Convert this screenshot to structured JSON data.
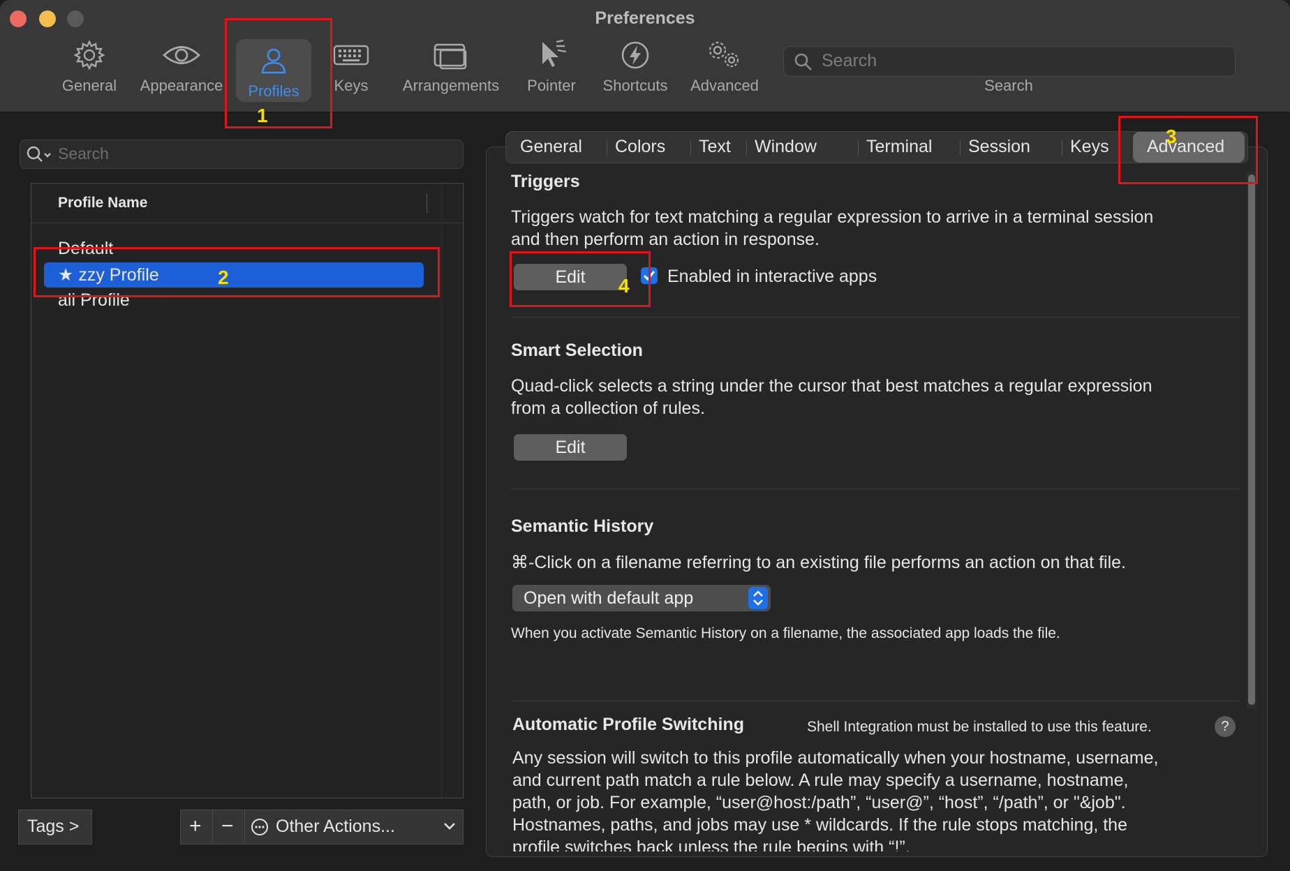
{
  "window": {
    "title": "Preferences"
  },
  "toolbar": {
    "items": [
      {
        "label": "General",
        "icon": "gear-icon"
      },
      {
        "label": "Appearance",
        "icon": "eye-icon"
      },
      {
        "label": "Profiles",
        "icon": "person-icon",
        "active": true
      },
      {
        "label": "Keys",
        "icon": "keyboard-icon"
      },
      {
        "label": "Arrangements",
        "icon": "windows-icon"
      },
      {
        "label": "Pointer",
        "icon": "pointer-icon"
      },
      {
        "label": "Shortcuts",
        "icon": "lightning-icon"
      },
      {
        "label": "Advanced",
        "icon": "gears-icon"
      }
    ],
    "search": {
      "placeholder": "Search",
      "label": "Search"
    }
  },
  "profiles": {
    "search_placeholder": "Search",
    "column_header": "Profile Name",
    "items": [
      {
        "name": "Default"
      },
      {
        "name": "★ zzy Profile",
        "selected": true
      },
      {
        "name": "ali Profile"
      }
    ],
    "tags_button": "Tags >",
    "add_button": "+",
    "remove_button": "−",
    "other_actions": "Other Actions..."
  },
  "tabs": {
    "items": [
      "General",
      "Colors",
      "Text",
      "Window",
      "Terminal",
      "Session",
      "Keys",
      "Advanced"
    ],
    "active": "Advanced"
  },
  "triggers": {
    "title": "Triggers",
    "desc_line1": "Triggers watch for text matching a regular expression to arrive in a terminal session",
    "desc_line2": "and then perform an action in response.",
    "edit_label": "Edit",
    "checkbox_label": "Enabled in interactive apps",
    "checkbox_checked": true
  },
  "smart_selection": {
    "title": "Smart Selection",
    "desc_line1": "Quad-click selects a string under the cursor that best matches a regular expression",
    "desc_line2": "from a collection of rules.",
    "edit_label": "Edit"
  },
  "semantic_history": {
    "title": "Semantic History",
    "desc": "⌘-Click on a filename referring to an existing file performs an action on that file.",
    "select_value": "Open with default app",
    "note": "When you activate Semantic History on a filename, the associated app loads the file."
  },
  "auto_switching": {
    "title": "Automatic Profile Switching",
    "shell_note": "Shell Integration must be installed to use this feature.",
    "help": "?",
    "line1": "Any session will switch to this profile automatically when your hostname, username,",
    "line2": "and current path match a rule below. A rule may specify a username, hostname,",
    "line3": "path, or job. For example, “user@host:/path”, “user@”, “host”, “/path”, or \"&job\".",
    "line4": "Hostnames, paths, and jobs may use * wildcards. If the rule stops matching, the",
    "line5": "profile switches back unless the rule begins with “!”."
  },
  "annotations": [
    "1",
    "2",
    "3",
    "4"
  ],
  "colors": {
    "accent": "#1f6fe6",
    "selection": "#1d5fd6",
    "annotation_box": "#e3131b",
    "annotation_number": "#f5e000"
  }
}
